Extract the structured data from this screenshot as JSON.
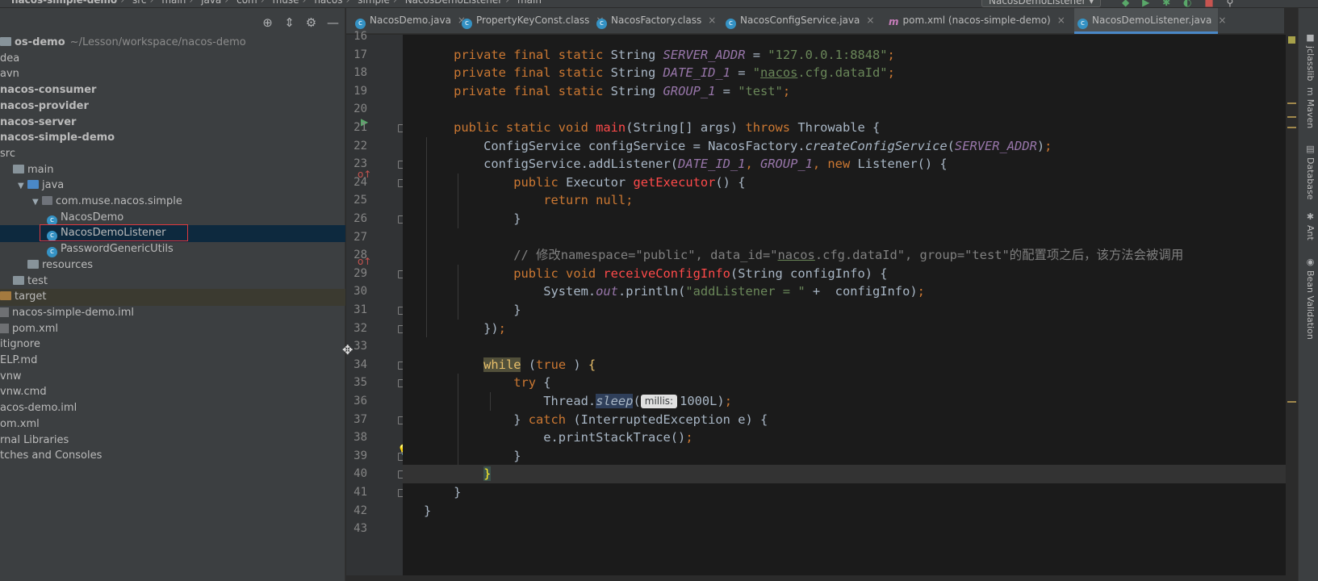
{
  "breadcrumbs": [
    "nacos-simple-demo",
    "src",
    "main",
    "java",
    "com",
    "muse",
    "nacos",
    "simple",
    "NacosDemoListener",
    "main"
  ],
  "run_config": "NacosDemoListener",
  "project_tree": [
    {
      "label": "os-demo",
      "suffix": "~/Lesson/workspace/nacos-demo",
      "bold": true,
      "indent": 0,
      "icon": "folder"
    },
    {
      "label": "dea",
      "indent": 0,
      "icon": "none"
    },
    {
      "label": "avn",
      "indent": 0,
      "icon": "none"
    },
    {
      "label": "nacos-consumer",
      "bold": true,
      "indent": 0,
      "icon": "none"
    },
    {
      "label": "nacos-provider",
      "bold": true,
      "indent": 0,
      "icon": "none"
    },
    {
      "label": "nacos-server",
      "bold": true,
      "indent": 0,
      "icon": "none"
    },
    {
      "label": "nacos-simple-demo",
      "bold": true,
      "indent": 0,
      "icon": "none"
    },
    {
      "label": "src",
      "indent": 0,
      "icon": "none"
    },
    {
      "label": "main",
      "indent": 1,
      "icon": "folder"
    },
    {
      "label": "java",
      "indent": 2,
      "icon": "folder-blue",
      "arrow": "expanded"
    },
    {
      "label": "com.muse.nacos.simple",
      "indent": 3,
      "icon": "package",
      "arrow": "expanded"
    },
    {
      "label": "NacosDemo",
      "indent": 4,
      "icon": "class"
    },
    {
      "label": "NacosDemoListener",
      "indent": 4,
      "icon": "class",
      "selected": true
    },
    {
      "label": "PasswordGenericUtils",
      "indent": 4,
      "icon": "class"
    },
    {
      "label": "resources",
      "indent": 2,
      "icon": "folder"
    },
    {
      "label": "test",
      "indent": 1,
      "icon": "folder"
    },
    {
      "label": "target",
      "indent": 0,
      "icon": "folder-orange",
      "excluded": true
    },
    {
      "label": "nacos-simple-demo.iml",
      "indent": 0,
      "icon": "file"
    },
    {
      "label": "pom.xml",
      "indent": 0,
      "icon": "file"
    },
    {
      "label": "itignore",
      "indent": 0,
      "icon": "none"
    },
    {
      "label": "ELP.md",
      "indent": 0,
      "icon": "none"
    },
    {
      "label": "vnw",
      "indent": 0,
      "icon": "none"
    },
    {
      "label": "vnw.cmd",
      "indent": 0,
      "icon": "none"
    },
    {
      "label": "acos-demo.iml",
      "indent": 0,
      "icon": "none"
    },
    {
      "label": "om.xml",
      "indent": 0,
      "icon": "none"
    },
    {
      "label": "rnal Libraries",
      "indent": 0,
      "icon": "none"
    },
    {
      "label": "tches and Consoles",
      "indent": 0,
      "icon": "none"
    }
  ],
  "tabs": [
    {
      "label": "NacosDemo.java",
      "icon": "class"
    },
    {
      "label": "PropertyKeyConst.class",
      "icon": "class"
    },
    {
      "label": "NacosFactory.class",
      "icon": "class"
    },
    {
      "label": "NacosConfigService.java",
      "icon": "class"
    },
    {
      "label": "pom.xml (nacos-simple-demo)",
      "icon": "maven"
    },
    {
      "label": "NacosDemoListener.java",
      "icon": "class",
      "active": true
    }
  ],
  "line_numbers": [
    "16",
    "17",
    "18",
    "19",
    "20",
    "21",
    "22",
    "23",
    "24",
    "25",
    "26",
    "27",
    "28",
    "29",
    "30",
    "31",
    "32",
    "33",
    "34",
    "35",
    "36",
    "37",
    "38",
    "39",
    "40",
    "41",
    "42",
    "43"
  ],
  "code_lines": [
    [],
    [
      [
        "kw",
        "    private final static "
      ],
      [
        "",
        "String "
      ],
      [
        "cfield",
        "SERVER_ADDR"
      ],
      [
        "",
        " = "
      ],
      [
        "str",
        "\"127.0.0.1:8848\""
      ],
      [
        "kw",
        ";"
      ]
    ],
    [
      [
        "kw",
        "    private final static "
      ],
      [
        "",
        "String "
      ],
      [
        "cfield",
        "DATE_ID_1"
      ],
      [
        "",
        " = "
      ],
      [
        "str",
        "\""
      ],
      [
        "str-u",
        "nacos"
      ],
      [
        "str",
        ".cfg.dataId\""
      ],
      [
        "kw",
        ";"
      ]
    ],
    [
      [
        "kw",
        "    private final static "
      ],
      [
        "",
        "String "
      ],
      [
        "cfield",
        "GROUP_1"
      ],
      [
        "",
        " = "
      ],
      [
        "str",
        "\"test\""
      ],
      [
        "kw",
        ";"
      ]
    ],
    [],
    [
      [
        "kw",
        "    public static void "
      ],
      [
        "mdecl",
        "main"
      ],
      [
        "",
        "(String[] args) "
      ],
      [
        "kw",
        "throws "
      ],
      [
        "",
        "Throwable {"
      ]
    ],
    [
      [
        "",
        "        ConfigService configService = NacosFactory."
      ],
      [
        "smeth",
        "createConfigService"
      ],
      [
        "",
        "("
      ],
      [
        "cfield",
        "SERVER_ADDR"
      ],
      [
        "",
        ")"
      ],
      [
        "kw",
        ";"
      ]
    ],
    [
      [
        "",
        "        configService.addListener("
      ],
      [
        "cfield",
        "DATE_ID_1"
      ],
      [
        "kw",
        ", "
      ],
      [
        "cfield",
        "GROUP_1"
      ],
      [
        "kw",
        ", new "
      ],
      [
        "",
        "Listener() {"
      ]
    ],
    [
      [
        "kw",
        "            public "
      ],
      [
        "",
        "Executor "
      ],
      [
        "mdecl",
        "getExecutor"
      ],
      [
        "",
        "() {"
      ]
    ],
    [
      [
        "kw",
        "                return null;"
      ]
    ],
    [
      [
        "",
        "            }"
      ]
    ],
    [],
    [
      [
        "cmt",
        "            // 修改namespace=\"public\", data_id=\""
      ],
      [
        "cmt-u",
        "nacos"
      ],
      [
        "cmt",
        ".cfg.dataId\", group=\"test\"的配置项之后，该方法会被调用"
      ]
    ],
    [
      [
        "kw",
        "            public void "
      ],
      [
        "mdecl",
        "receiveConfigInfo"
      ],
      [
        "",
        "(String configInfo) {"
      ]
    ],
    [
      [
        "",
        "                System."
      ],
      [
        "cfield",
        "out"
      ],
      [
        "",
        ".println("
      ],
      [
        "str",
        "\"addListener = \""
      ],
      [
        "",
        " +  configInfo)"
      ],
      [
        "kw",
        ";"
      ]
    ],
    [
      [
        "",
        "            }"
      ]
    ],
    [
      [
        "",
        "        })"
      ],
      [
        "kw",
        ";"
      ]
    ],
    [],
    [
      [
        "",
        "        "
      ],
      [
        "while",
        "while"
      ],
      [
        "",
        " ("
      ],
      [
        "kw",
        "true"
      ],
      [
        "",
        " ) "
      ],
      [
        "k",
        "{"
      ]
    ],
    [
      [
        "kw",
        "            try "
      ],
      [
        "",
        "{"
      ]
    ],
    [
      [
        "",
        "                Thread."
      ],
      [
        "sleep",
        "sleep"
      ],
      [
        "",
        "("
      ],
      [
        "hint",
        "millis:"
      ],
      [
        "",
        "1000L)"
      ],
      [
        "kw",
        ";"
      ]
    ],
    [
      [
        "",
        "            } "
      ],
      [
        "kw",
        "catch "
      ],
      [
        "",
        "(InterruptedException e) {"
      ]
    ],
    [
      [
        "",
        "                e.printStackTrace()"
      ],
      [
        "kw",
        ";"
      ]
    ],
    [
      [
        "",
        "            }"
      ]
    ],
    [
      [
        "",
        "        "
      ],
      [
        "brace",
        "}"
      ]
    ],
    [
      [
        "",
        "    }"
      ]
    ],
    [
      [
        "",
        "}"
      ]
    ],
    []
  ],
  "right_tools": [
    {
      "label": "jclasslib",
      "icon": "■"
    },
    {
      "label": "Maven",
      "icon": "m"
    },
    {
      "label": "Database",
      "icon": "▤"
    },
    {
      "label": "Ant",
      "icon": "✱"
    },
    {
      "label": "Bean Validation",
      "icon": "◉"
    }
  ],
  "colors": {
    "accent": "#4a88c7",
    "keyword": "#cc7832",
    "string": "#6a8759",
    "field": "#9876aa",
    "method_decl": "#ff4a4a",
    "selection_box": "#e0393e"
  }
}
